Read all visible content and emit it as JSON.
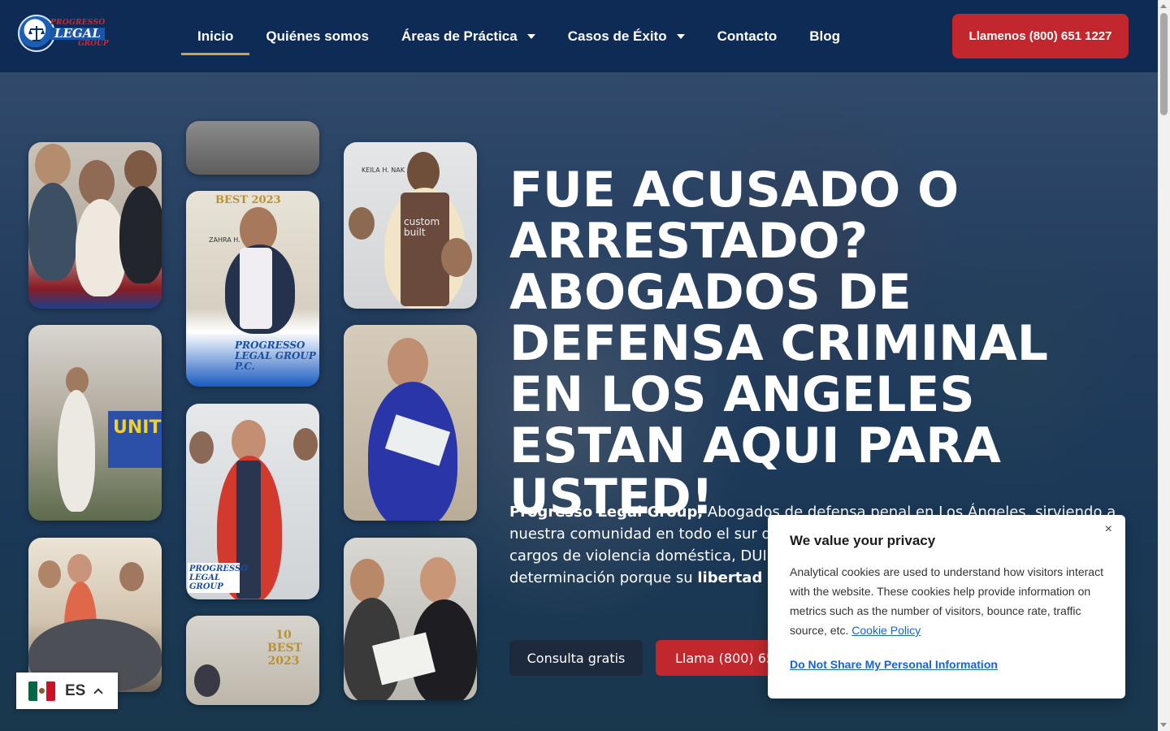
{
  "logo": {
    "line1": "PROGRESSO",
    "line2": "LEGAL",
    "line3": "GROUP"
  },
  "nav": {
    "items": [
      {
        "label": "Inicio",
        "active": true,
        "dropdown": false
      },
      {
        "label": "Quiénes somos",
        "active": false,
        "dropdown": false
      },
      {
        "label": "Áreas de Práctica",
        "active": false,
        "dropdown": true
      },
      {
        "label": "Casos de Éxito",
        "active": false,
        "dropdown": true
      },
      {
        "label": "Contacto",
        "active": false,
        "dropdown": false
      },
      {
        "label": "Blog",
        "active": false,
        "dropdown": false
      }
    ],
    "call_label": "Llamenos (800) 651 1227"
  },
  "hero": {
    "title": "FUE ACUSADO O ARRESTADO? ABOGADOS DE DEFENSA CRIMINAL EN LOS ANGELES ESTAN AQUI PARA USTED!",
    "body_brand": "Progresso Legal Group,",
    "body_text": " Abogados de defensa penal en Los Ángeles, sirviendo a nuestra comunidad en todo el sur de California. Defendemos sus derechos frente a cargos de violencia doméstica, DUI, delitos de drogas y más. Luchamos con determinación porque su ",
    "body_strong": "libertad son nuestra prioridad.",
    "consult_label": "Consulta gratis",
    "call_label": "Llama (800) 651 1227",
    "photo_texts": {
      "logo_badge": "PROGRESSO LEGAL GROUP P.C.",
      "logo_small": "PROGRESSO LEGAL GROUP",
      "award_1": "BEST 2023",
      "award_2": "10 BEST 2023",
      "sign_unity": "UNIT",
      "name_tag_1": "ZAHRA H.",
      "name_tag_2": "KEILA H. NAK",
      "shirt_text": "custom built"
    }
  },
  "privacy": {
    "title": "We value your privacy",
    "text": "Analytical cookies are used to understand how visitors interact with the website. These cookies help provide information on metrics such as the number of visitors, bounce rate, traffic source, etc.",
    "policy_link": "Cookie Policy",
    "dns_link": "Do Not Share My Personal Information",
    "close": "×"
  },
  "language": {
    "code": "ES"
  },
  "colors": {
    "header": "#0e2b55",
    "accent_red": "#c1272d",
    "underline_gold": "#c9a44c",
    "link_blue": "#1863dc"
  }
}
